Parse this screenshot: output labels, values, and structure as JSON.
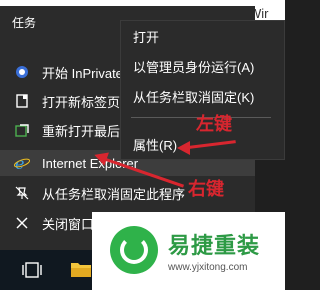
{
  "window_partial_text": "Wir",
  "jumplist": {
    "title": "任务",
    "items": [
      {
        "label": "开始 InPrivate",
        "icon": "inprivate-icon"
      },
      {
        "label": "打开新标签页",
        "icon": "new-tab-icon"
      },
      {
        "label": "重新打开最后",
        "icon": "reopen-icon"
      },
      {
        "label": "Internet Explorer",
        "icon": "ie-icon"
      },
      {
        "label": "从任务栏取消固定此程序",
        "icon": "unpin-icon"
      },
      {
        "label": "关闭窗口",
        "icon": "close-icon"
      }
    ]
  },
  "context_menu": {
    "items": [
      {
        "label": "打开"
      },
      {
        "label": "以管理员身份运行(A)"
      },
      {
        "label": "从任务栏取消固定(K)"
      },
      {
        "label": "属性(R)"
      }
    ]
  },
  "annotations": {
    "left_click": "左键",
    "right_click": "右键"
  },
  "badge": {
    "brand": "易捷重装",
    "url": "www.yjxitong.com"
  },
  "colors": {
    "annotation_red": "#d8262f",
    "brand_green": "#2fb24a",
    "menu_bg": "#2b2b2b"
  }
}
